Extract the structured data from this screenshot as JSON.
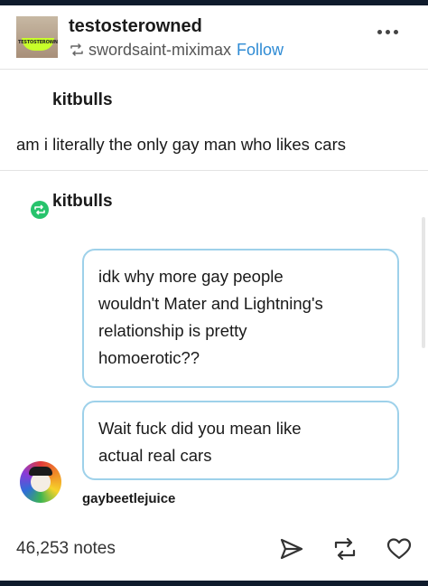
{
  "header": {
    "blog_name": "testosterowned",
    "avatar_text": "TESTOSTEROWNED",
    "reblogged_from": "swordsaint-miximax",
    "follow_label": "Follow"
  },
  "post": {
    "author": "kitbulls",
    "text": "am i literally the only gay man who likes cars"
  },
  "reblog": {
    "author": "kitbulls",
    "ask_lines": [
      "idk why more gay people",
      "wouldn't Mater and Lightning's",
      "relationship is pretty",
      "homoerotic??"
    ],
    "reply_lines": [
      "Wait fuck did you mean like",
      "actual real cars"
    ],
    "asker": "gaybeetlejuice"
  },
  "footer": {
    "notes": "46,253 notes"
  },
  "icons": {
    "reblog_badge_color": "#27c36c",
    "follow_color": "#2e8bd4",
    "bubble_border_color": "#9ed1ea"
  }
}
